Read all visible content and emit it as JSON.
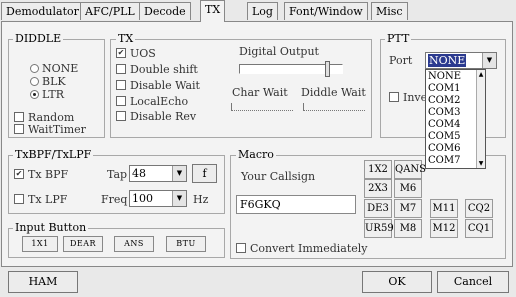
{
  "tabs": [
    {
      "label": "Demodulator"
    },
    {
      "label": "AFC/PLL"
    },
    {
      "label": "Decode"
    },
    {
      "label": "TX",
      "active": true
    },
    {
      "label": "Log"
    },
    {
      "label": "Font/Window"
    },
    {
      "label": "Misc"
    }
  ],
  "diddle": {
    "title": "DIDDLE",
    "options": [
      "NONE",
      "BLK",
      "LTR"
    ],
    "selected": "LTR",
    "random": {
      "label": "Random",
      "checked": false
    },
    "waittimer": {
      "label": "WaitTimer",
      "checked": false
    }
  },
  "tx": {
    "title": "TX",
    "uos": {
      "label": "UOS",
      "checked": true
    },
    "double_shift": {
      "label": "Double shift",
      "checked": false
    },
    "disable_wait": {
      "label": "Disable Wait",
      "checked": false
    },
    "local_echo": {
      "label": "LocalEcho",
      "checked": false
    },
    "disable_rev": {
      "label": "Disable Rev",
      "checked": false
    },
    "digital_output_label": "Digital Output",
    "digital_output_level": 0.88,
    "char_wait_label": "Char Wait",
    "diddle_wait_label": "Diddle Wait"
  },
  "ptt": {
    "title": "PTT",
    "port_label": "Port",
    "port_value": "NONE",
    "invert_label_partial": "Inve",
    "options": [
      "NONE",
      "COM1",
      "COM2",
      "COM3",
      "COM4",
      "COM5",
      "COM6",
      "COM7"
    ]
  },
  "txbpf": {
    "title": "TxBPF/TxLPF",
    "tx_bpf": {
      "label": "Tx BPF",
      "checked": true
    },
    "tap_label": "Tap",
    "tap_value": "48",
    "f_button": "f",
    "tx_lpf": {
      "label": "Tx LPF",
      "checked": false
    },
    "freq_label": "Freq",
    "freq_value": "100",
    "hz_label": "Hz"
  },
  "input_button": {
    "title": "Input Button",
    "buttons": [
      "1X1",
      "DEAR",
      "ANS",
      "BTU"
    ]
  },
  "macro": {
    "title": "Macro",
    "your_callsign_label": "Your Callsign",
    "callsign_value": "F6GKQ",
    "buttons": [
      [
        "1X2",
        "QANS",
        "",
        ""
      ],
      [
        "2X3",
        "M6",
        "",
        ""
      ],
      [
        "DE3",
        "M7",
        "M11",
        "CQ2"
      ],
      [
        "UR599",
        "M8",
        "M12",
        "CQ1"
      ]
    ],
    "convert_immediately": {
      "label": "Convert Immediately",
      "checked": false
    }
  },
  "footer": {
    "ham": "HAM",
    "ok": "OK",
    "cancel": "Cancel"
  },
  "icons": {
    "check": "✔",
    "dropdown": "▼"
  }
}
